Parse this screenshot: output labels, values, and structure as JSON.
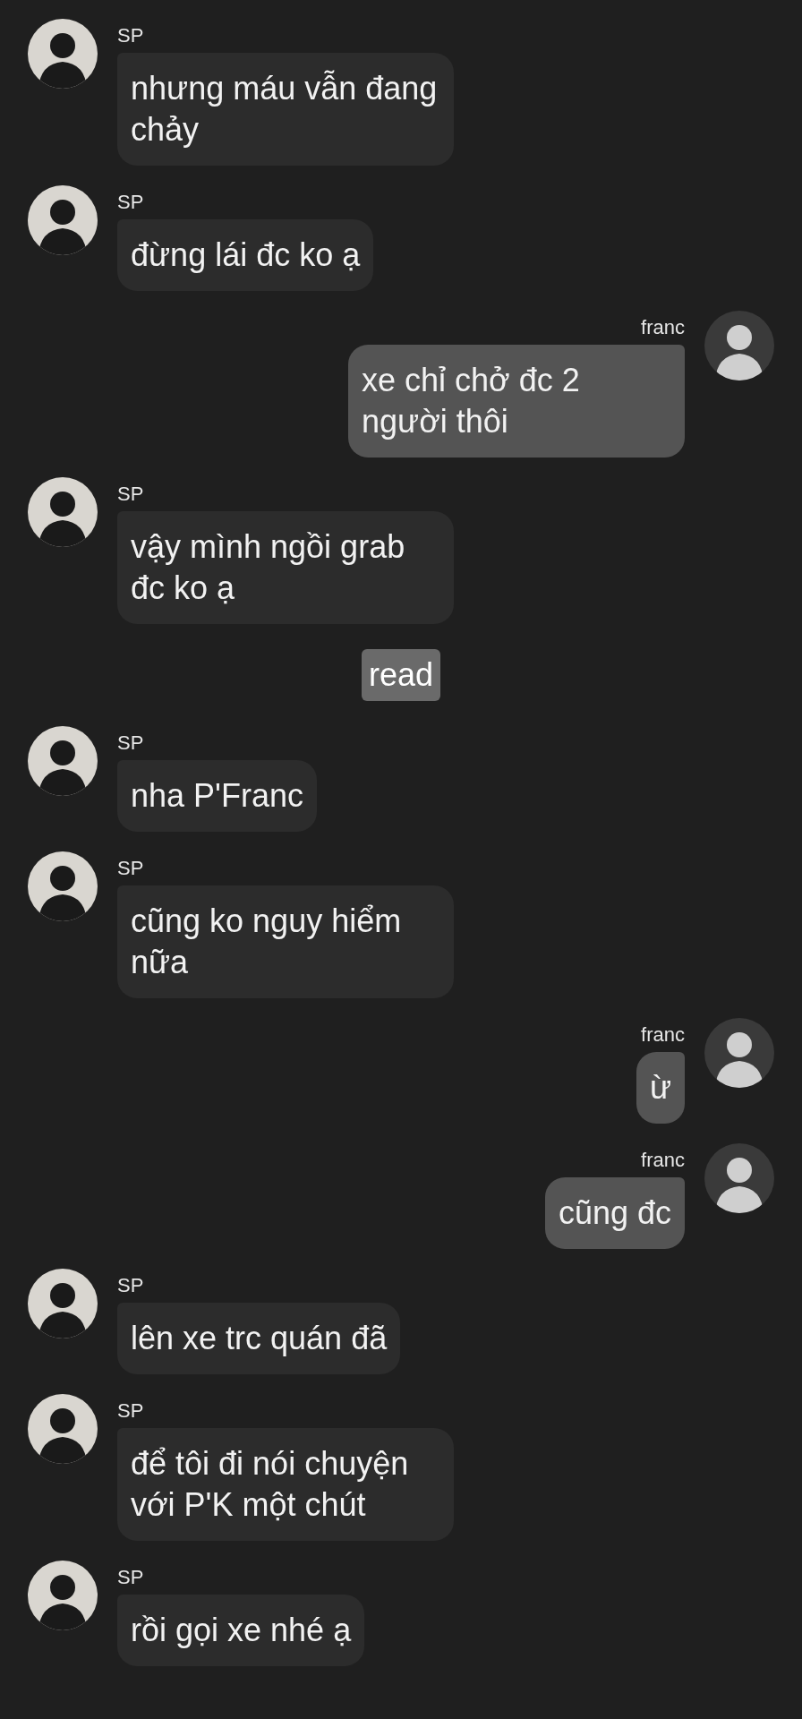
{
  "messages": [
    {
      "kind": "incoming",
      "sender": "SP",
      "text": "nhưng máu vẫn đang chảy"
    },
    {
      "kind": "incoming",
      "sender": "SP",
      "text": "đừng lái đc ko ạ"
    },
    {
      "kind": "outgoing",
      "sender": "franc",
      "text": "xe chỉ chở đc 2 người thôi"
    },
    {
      "kind": "incoming",
      "sender": "SP",
      "text": "vậy mình ngồi grab đc ko ạ"
    },
    {
      "kind": "status",
      "text": "read"
    },
    {
      "kind": "incoming",
      "sender": "SP",
      "text": "nha P'Franc"
    },
    {
      "kind": "incoming",
      "sender": "SP",
      "text": "cũng ko nguy hiểm nữa"
    },
    {
      "kind": "outgoing",
      "sender": "franc",
      "text": "ừ"
    },
    {
      "kind": "outgoing",
      "sender": "franc",
      "text": "cũng đc"
    },
    {
      "kind": "incoming",
      "sender": "SP",
      "text": "lên xe trc quán đã"
    },
    {
      "kind": "incoming",
      "sender": "SP",
      "text": "để tôi đi nói chuyện với P'K một chút"
    },
    {
      "kind": "incoming",
      "sender": "SP",
      "text": "rồi gọi xe nhé ạ"
    }
  ]
}
